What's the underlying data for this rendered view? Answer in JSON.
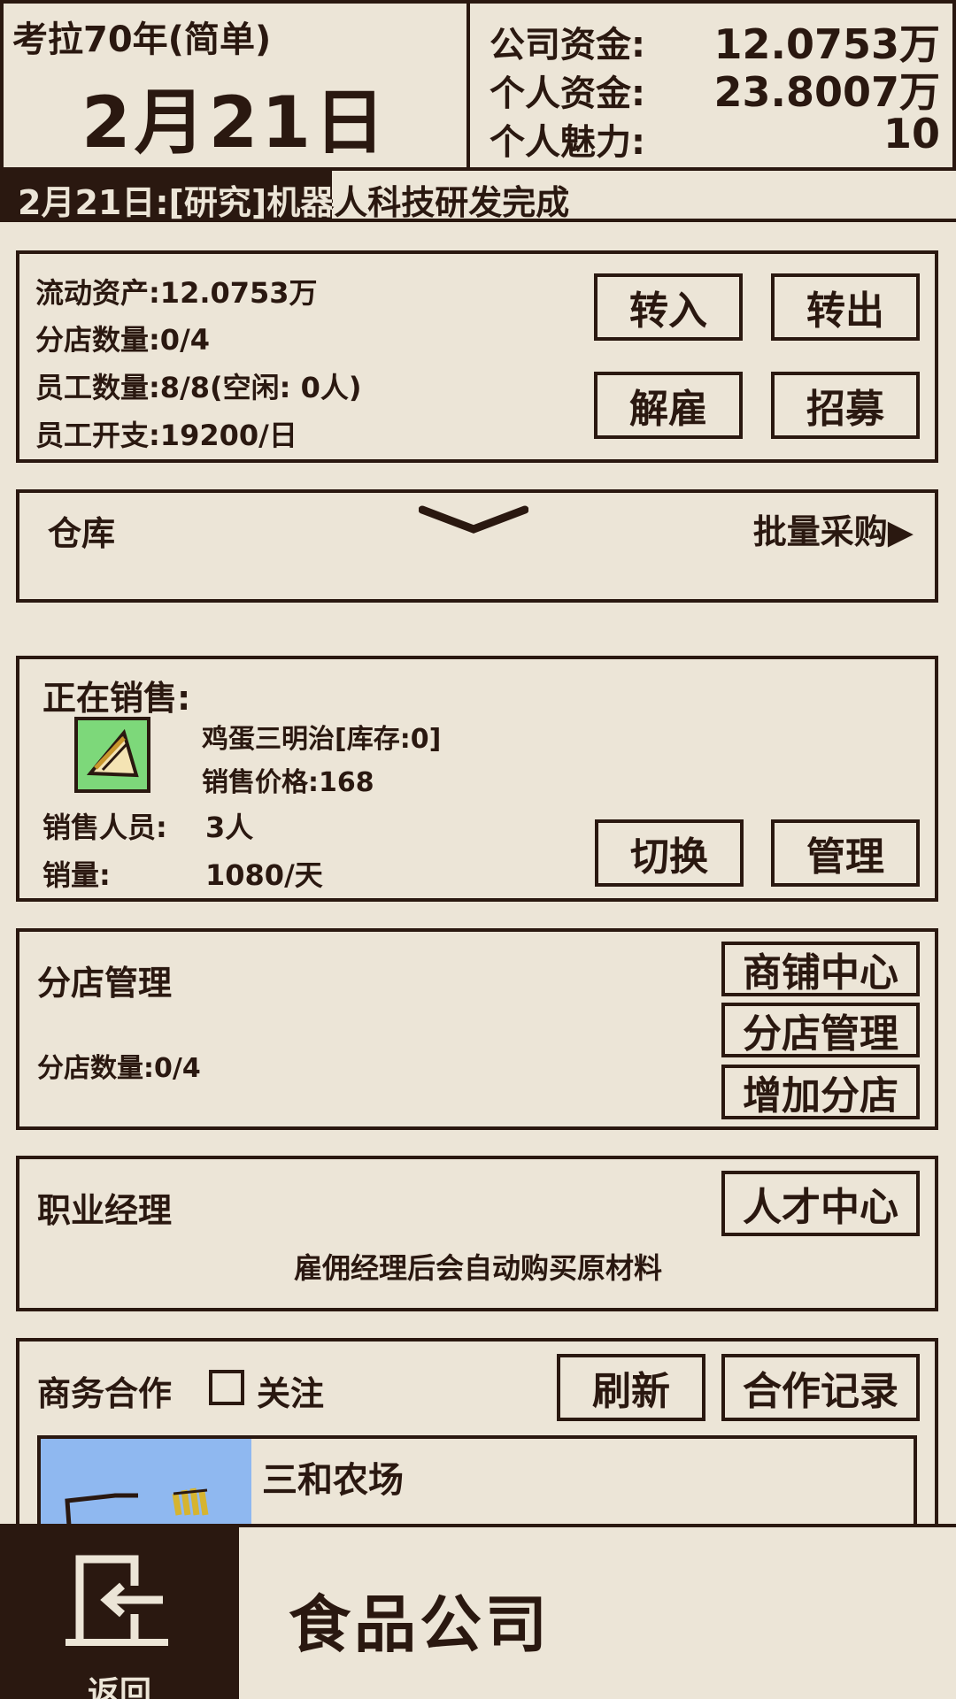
{
  "header": {
    "game_title": "考拉70年(简单)",
    "date": "2月21日",
    "company_funds_label": "公司资金:",
    "company_funds_value": "12.0753万",
    "personal_funds_label": "个人资金:",
    "personal_funds_value": "23.8007万",
    "charisma_label": "个人魅力:",
    "charisma_value": "10"
  },
  "ticker": {
    "message": "2月21日:[研究]机器人科技研发完成"
  },
  "finance": {
    "liquid_assets": "流动资产:12.0753万",
    "branch_count": "分店数量:0/4",
    "employee_count": "员工数量:8/8(空闲: 0人)",
    "employee_cost": "员工开支:19200/日",
    "transfer_in": "转入",
    "transfer_out": "转出",
    "fire": "解雇",
    "recruit": "招募"
  },
  "warehouse": {
    "title": "仓库",
    "bulk_purchase": "批量采购▶"
  },
  "sales": {
    "title": "正在销售:",
    "product_name": "鸡蛋三明治[库存:0]",
    "price": "销售价格:168",
    "staff_label": "销售人员:",
    "staff_value": "3人",
    "volume_label": "销量:",
    "volume_value": "1080/天",
    "switch": "切换",
    "manage": "管理",
    "product_icon": "sandwich-icon"
  },
  "branch": {
    "title": "分店管理",
    "count": "分店数量:0/4",
    "shop_center": "商铺中心",
    "branch_manage": "分店管理",
    "add_branch": "增加分店"
  },
  "manager": {
    "title": "职业经理",
    "talent_center": "人才中心",
    "hint": "雇佣经理后会自动购买原材料"
  },
  "business": {
    "title": "商务合作",
    "follow_label": "关注",
    "follow_checked": false,
    "refresh": "刷新",
    "records": "合作记录",
    "partner_name": "三和农场"
  },
  "bottom": {
    "back_label": "返回",
    "page_title": "食品公司"
  },
  "colors": {
    "background": "#ece5d7",
    "ink": "#2a1810",
    "icon_green": "#7dd87a",
    "partner_sky": "#8fb8f0"
  }
}
